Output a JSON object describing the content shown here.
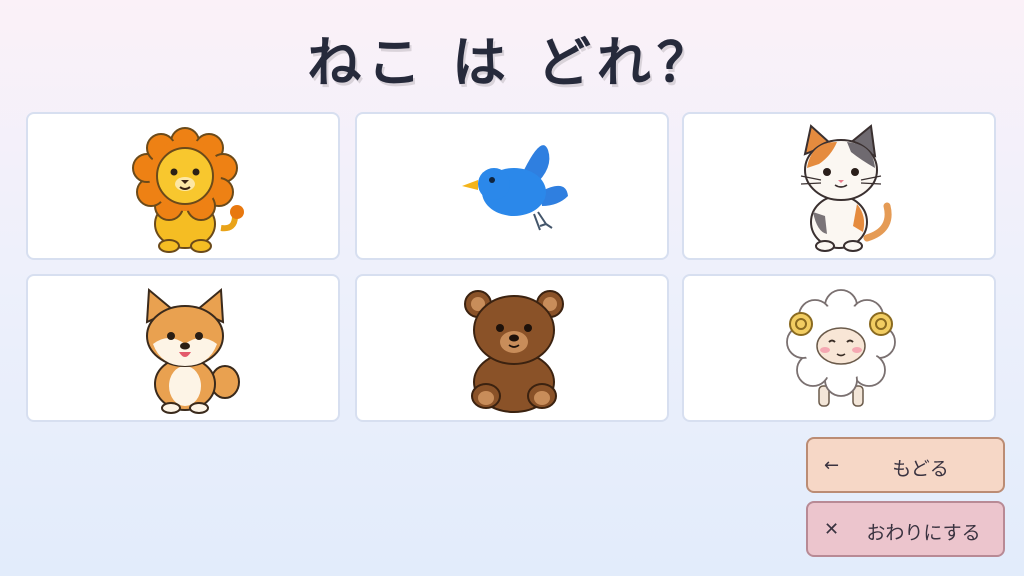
{
  "question": {
    "title": "ねこ は どれ？"
  },
  "choices": [
    {
      "icon": "lion-icon"
    },
    {
      "icon": "bird-icon"
    },
    {
      "icon": "cat-icon"
    },
    {
      "icon": "shiba-dog-icon"
    },
    {
      "icon": "bear-icon"
    },
    {
      "icon": "sheep-icon"
    }
  ],
  "buttons": {
    "back_icon": "←",
    "back_label": "もどる",
    "quit_icon": "✕",
    "quit_label": "おわりにする"
  },
  "colors": {
    "title": "#262a3b",
    "back_button": "#f6d7c6",
    "quit_button": "#ecc5cd"
  }
}
